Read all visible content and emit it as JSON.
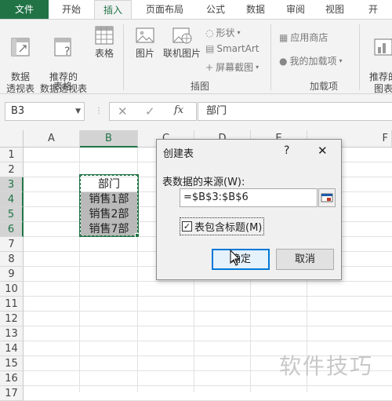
{
  "tabs": [
    "文件",
    "开始",
    "插入",
    "页面布局",
    "公式",
    "数据",
    "审阅",
    "视图",
    "开"
  ],
  "ribbon": {
    "tables_group": {
      "label": "表格",
      "pivot": "数据\n透视表",
      "recommended_pivot": "推荐的\n数据透视表",
      "table": "表格"
    },
    "illustrations_group": {
      "label": "插图",
      "pictures": "图片",
      "online_pictures": "联机图片",
      "shapes": "形状",
      "smartart": "SmartArt",
      "screenshot": "屏幕截图"
    },
    "addins_group": {
      "label": "加载项",
      "store": "应用商店",
      "my_addins": "我的加载项"
    },
    "charts_partial": "推荐的\n图表"
  },
  "formula_bar": {
    "name_box": "B3",
    "fx": "fx",
    "formula": "部门"
  },
  "grid": {
    "columns": [
      "A",
      "B",
      "C",
      "D",
      "E",
      "F"
    ],
    "rows": [
      "1",
      "2",
      "3",
      "4",
      "5",
      "6",
      "7",
      "8",
      "9",
      "10",
      "11",
      "12",
      "13",
      "14",
      "15",
      "16",
      "17",
      "18"
    ],
    "cells": [
      "部门",
      "销售1部",
      "销售2部",
      "销售7部"
    ]
  },
  "dialog": {
    "title": "创建表",
    "help": "?",
    "close": "✕",
    "source_label": "表数据的来源(W):",
    "range": "=$B$3:$B$6",
    "checkbox_label": "表包含标题(M)",
    "checkbox_checked": true,
    "ok": "确定",
    "cancel": "取消"
  },
  "watermark": "软件技巧",
  "colors": {
    "excel_green": "#217346",
    "dialog_bg": "#f0f0f0",
    "ok_border": "#0078d7"
  }
}
